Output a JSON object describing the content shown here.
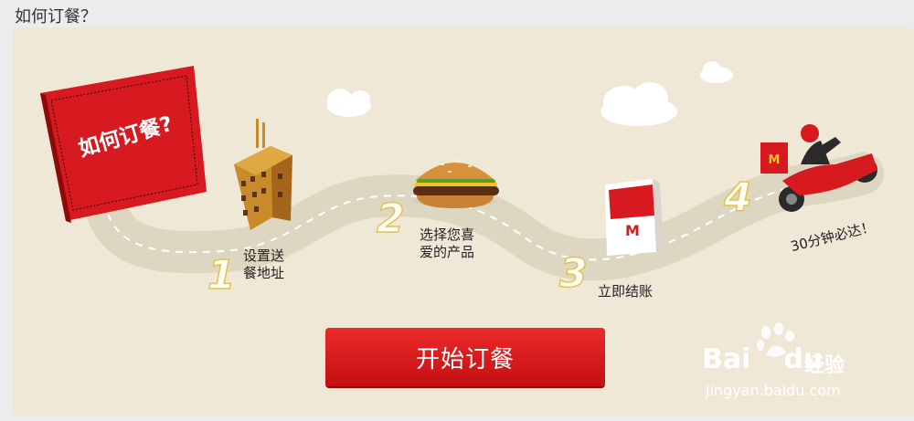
{
  "page": {
    "title": "如何订餐？"
  },
  "banner": {
    "sign_label": "如何订餐?",
    "steps": [
      {
        "number": "1",
        "label": "设置送\n餐地址"
      },
      {
        "number": "2",
        "label": "选择您喜\n爱的产品"
      },
      {
        "number": "3",
        "label": "立即结账"
      },
      {
        "number": "4",
        "label": "30分钟必达！"
      }
    ],
    "cta_label": "开始订餐",
    "bag_logo": "M"
  },
  "watermark": {
    "brand_text": "Bai",
    "brand_text_end": "du",
    "suffix_text": "经验",
    "url_text": "jingyan.baidu.com"
  },
  "colors": {
    "accent_red": "#d71a1f",
    "banner_bg": "#f0e8d6",
    "road": "#ddd7c1",
    "step_number_outline": "#e2c24f"
  }
}
